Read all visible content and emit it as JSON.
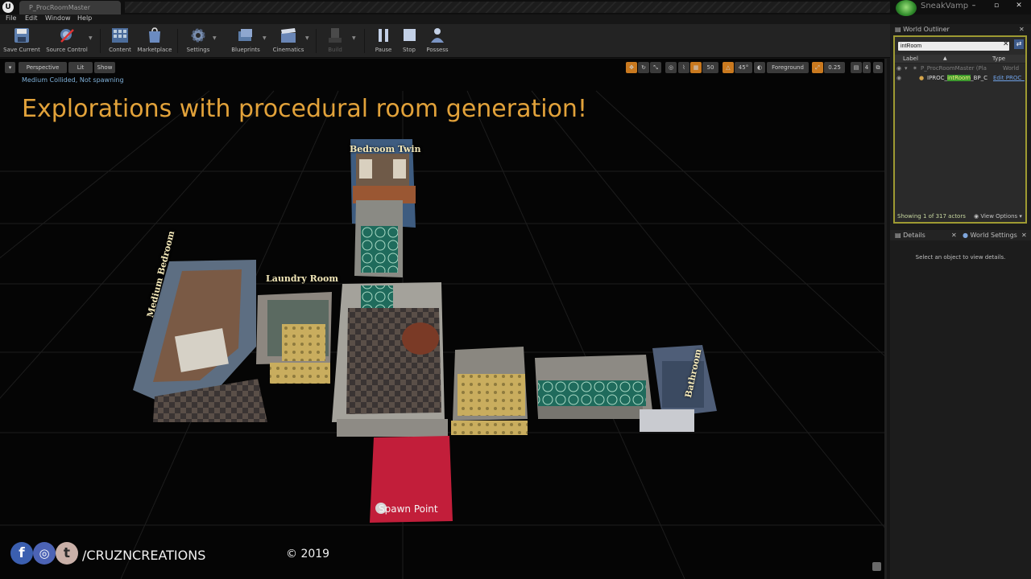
{
  "window": {
    "tab_title": "P_ProcRoomMaster",
    "user_name": "SneakVamp",
    "minimize": "–",
    "maximize": "▫",
    "close": "✕"
  },
  "menu": [
    "File",
    "Edit",
    "Window",
    "Help"
  ],
  "toolbar": {
    "save_current": "Save Current",
    "source_control": "Source Control",
    "content": "Content",
    "marketplace": "Marketplace",
    "settings": "Settings",
    "blueprints": "Blueprints",
    "cinematics": "Cinematics",
    "build": "Build",
    "pause": "Pause",
    "stop": "Stop",
    "possess": "Possess"
  },
  "viewport": {
    "perspective": "Perspective",
    "lit": "Lit",
    "show": "Show",
    "grid_size": "50",
    "rotation_snap": "45°",
    "layer": "Foreground",
    "scale_snap": "0.25",
    "camera_speed": "4",
    "status": "Medium Collided, Not spawning",
    "caption": "Explorations with procedural room generation!",
    "rooms": {
      "bedroom_twin": "Bedroom Twin",
      "laundry_room": "Laundry Room",
      "medium_bedroom": "Medium Bedroom",
      "bathroom": "Bathroom",
      "spawn_point": "Spawn Point"
    },
    "social_handle": "/CRUZNCREATIONS",
    "copyright": "© 2019"
  },
  "outliner": {
    "title": "World Outliner",
    "search_value": "intRoom",
    "col_label": "Label",
    "col_type": "Type",
    "rows": [
      {
        "label": "P_ProcRoomMaster (Pla",
        "type": "World"
      },
      {
        "label_prefix": "IPROC_",
        "label_match": "intRoom",
        "label_suffix": "_BP_C",
        "type": "Edit PROC_"
      }
    ],
    "showing": "Showing 1 of 317 actors",
    "view_options": "View Options"
  },
  "details": {
    "tab_details": "Details",
    "tab_world_settings": "World Settings",
    "empty_msg": "Select an object to view details."
  },
  "colors": {
    "accent_orange": "#c9791f",
    "caption": "#e2a23a",
    "outliner_highlight": "#9e9a32",
    "spawn_red": "#c21e3a"
  }
}
